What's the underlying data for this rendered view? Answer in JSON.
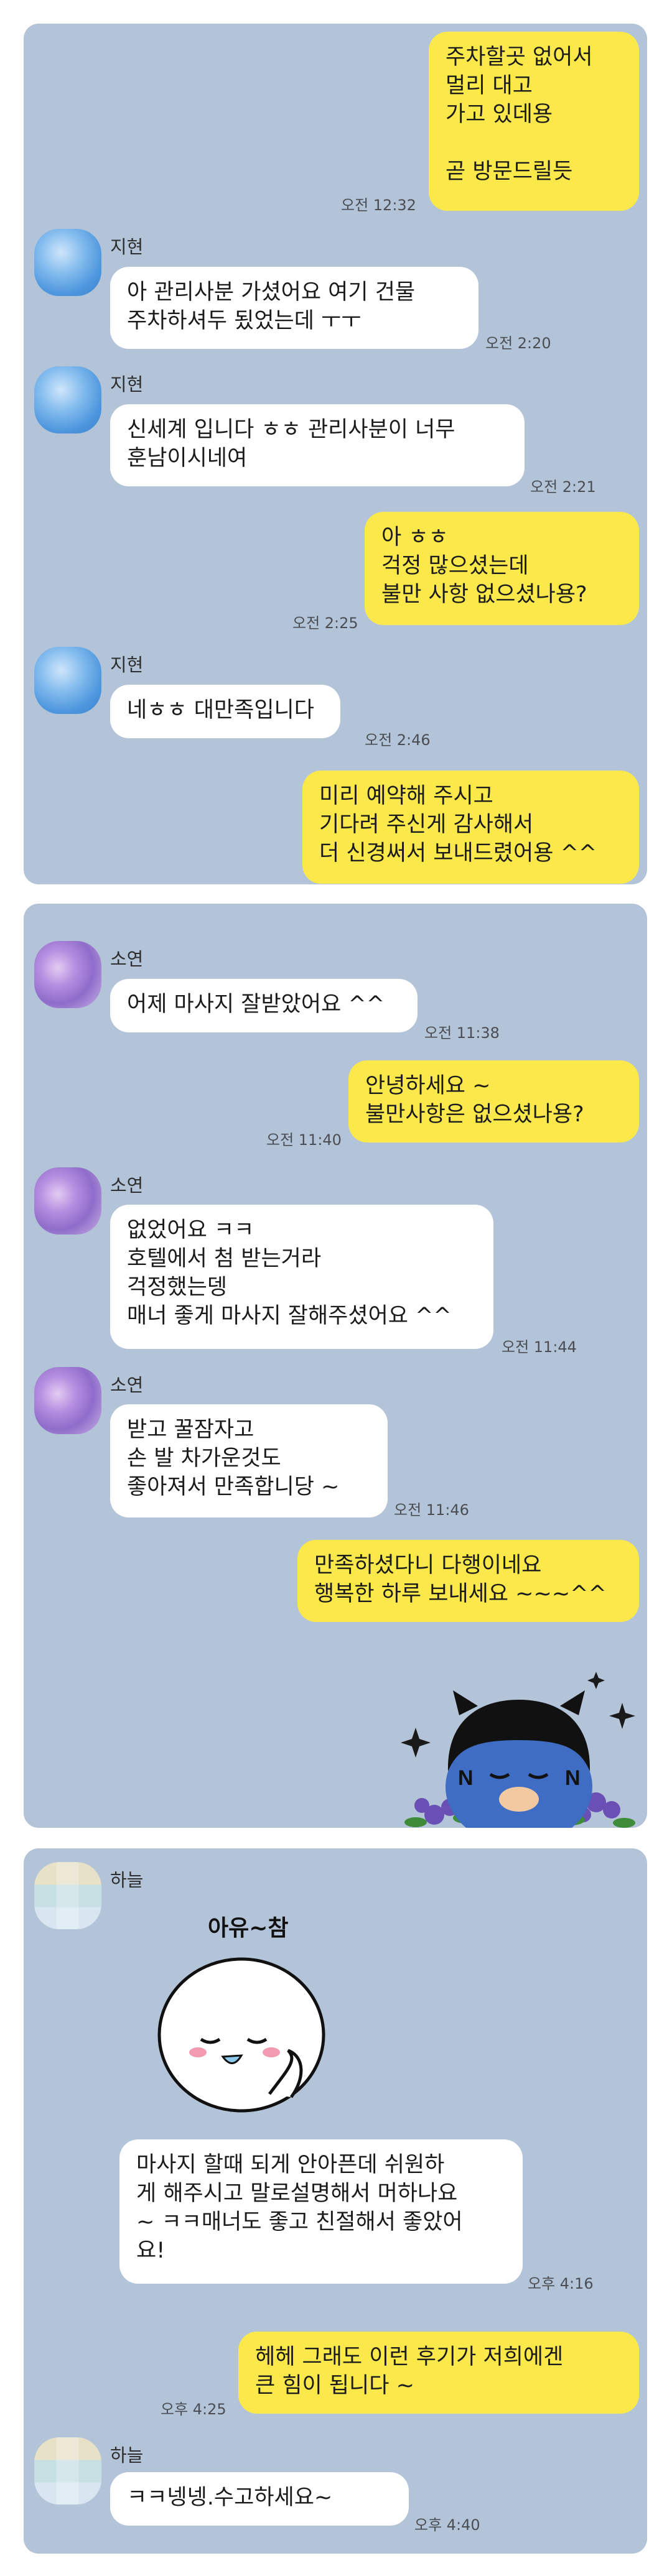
{
  "chat1": {
    "messages": [
      {
        "sender": "",
        "text": "주차할곳 없어서\n멀리 대고\n가고 있데용\n\n곧 방문드릴듯",
        "time": "오전 12:32"
      },
      {
        "sender": "지현",
        "text": "아 관리사분 가셨어요 여기 건물\n주차하셔두 됬었는데 ㅜㅜ",
        "time": "오전 2:20"
      },
      {
        "sender": "지현",
        "text": "신세계 입니다 ㅎㅎ 관리사분이 너무\n훈남이시네여",
        "time": "오전 2:21"
      },
      {
        "sender": "",
        "text": "아 ㅎㅎ\n걱정 많으셨는데\n불만 사항 없으셨나용?",
        "time": "오전 2:25"
      },
      {
        "sender": "지현",
        "text": "네ㅎㅎ 대만족입니다",
        "time": "오전 2:46"
      },
      {
        "sender": "",
        "text": "미리 예약해 주시고\n기다려 주신게 감사해서\n더 신경써서 보내드렸어용 ^^",
        "time": ""
      }
    ]
  },
  "chat2": {
    "messages": [
      {
        "sender": "소연",
        "text": "어제 마사지 잘받았어요 ^^",
        "time": "오전 11:38"
      },
      {
        "sender": "",
        "text": "안녕하세요 ~\n불만사항은 없으셨나용?",
        "time": "오전 11:40"
      },
      {
        "sender": "소연",
        "text": "없었어요 ㅋㅋ\n호텔에서 첨 받는거라\n걱정했는뎅\n매너 좋게 마사지 잘해주셨어요 ^^",
        "time": "오전 11:44"
      },
      {
        "sender": "소연",
        "text": "받고 꿀잠자고\n손 발 차가운것도\n좋아져서 만족합니당 ~",
        "time": "오전 11:46"
      },
      {
        "sender": "",
        "text": "만족하셨다니 다행이네요\n행복한 하루 보내세요 ~~~^^",
        "time": ""
      }
    ],
    "sticker_letter": "N"
  },
  "chat3": {
    "sender": "하늘",
    "sticker_text": "아유~참",
    "messages": [
      {
        "sender": "하늘",
        "text": "마사지 할때 되게 안아픈데 쉬원하\n게 해주시고 말로설명해서 머하나요\n~ ㅋㅋ매너도 좋고 친절해서 좋았어\n요!",
        "time": "오후 4:16"
      },
      {
        "sender": "",
        "text": "헤헤 그래도 이런 후기가 저희에겐\n큰 힘이 됩니다 ~",
        "time": "오후 4:25"
      },
      {
        "sender": "하늘",
        "text": "ㅋㅋ넹넹.수고하세요~",
        "time": "오후 4:40"
      }
    ]
  },
  "colors": {
    "panel": "#b3c4d8",
    "incoming": "#ffffff",
    "outgoing": "#fbe84b"
  }
}
